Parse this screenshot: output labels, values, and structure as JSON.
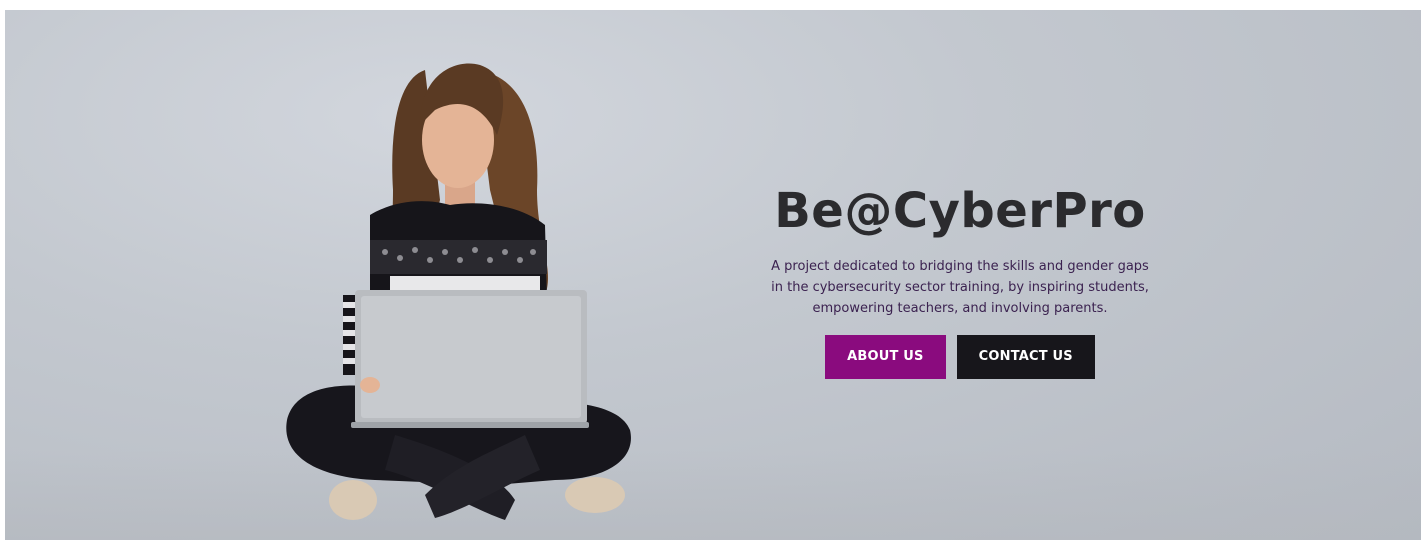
{
  "hero": {
    "title": "Be@CyberPro",
    "description": "A project dedicated to bridging the skills and gender gaps in the cybersecurity sector training, by inspiring students, empowering teachers, and involving parents.",
    "buttons": {
      "about_label": "ABOUT US",
      "contact_label": "CONTACT US"
    },
    "colors": {
      "about_button": "#8a0b7e",
      "contact_button": "#17161b",
      "title_text": "#2b2b2e",
      "background": "#c3c8cf"
    },
    "image_subject": "woman-with-laptop"
  }
}
